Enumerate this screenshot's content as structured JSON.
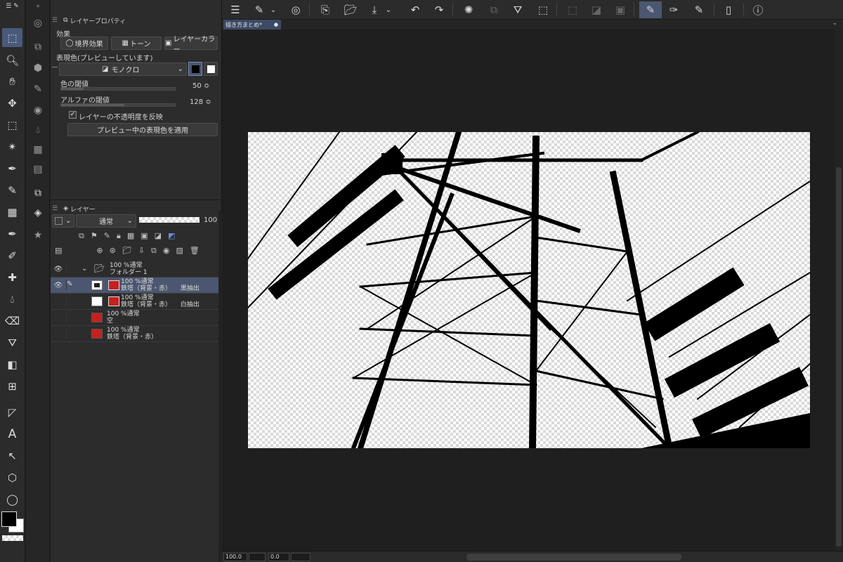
{
  "properties_panel": {
    "tab_label": "レイヤープロパティ",
    "effect_label": "効果",
    "effects": [
      "境界効果",
      "トーン",
      "レイヤーカラー"
    ],
    "expression_label": "表現色(プレビューしています)",
    "expression_value": "モノクロ",
    "color_threshold_label": "色の閾値",
    "color_threshold_value": "50",
    "alpha_threshold_label": "アルファの閾値",
    "alpha_threshold_value": "128",
    "reflect_opacity_label": "レイヤーの不透明度を反映",
    "apply_button": "プレビュー中の表現色を適用"
  },
  "layer_panel": {
    "tab_label": "レイヤー",
    "blend_mode": "通常",
    "opacity_value": "100",
    "layers": [
      {
        "line1": "100 %通常",
        "line2": "フォルダー 1",
        "suffix": ""
      },
      {
        "line1": "100 %通常",
        "line2": "鉄塔（背景・赤）",
        "suffix": "黒抽出"
      },
      {
        "line1": "100 %通常",
        "line2": "鉄塔（背景・赤）",
        "suffix": "白抽出"
      },
      {
        "line1": "100 %通常",
        "line2": "空",
        "suffix": ""
      },
      {
        "line1": "100 %通常",
        "line2": "鉄塔（背景・赤）",
        "suffix": ""
      }
    ]
  },
  "document_tab": "描き方まとめ*",
  "status": {
    "zoom": "100.0",
    "rotation": "0.0"
  },
  "colors": {
    "accent": "#4b5670",
    "panel": "#2c2c2c",
    "canvas_bg": "#1f1f1f",
    "thumb_red": "#c62020"
  }
}
